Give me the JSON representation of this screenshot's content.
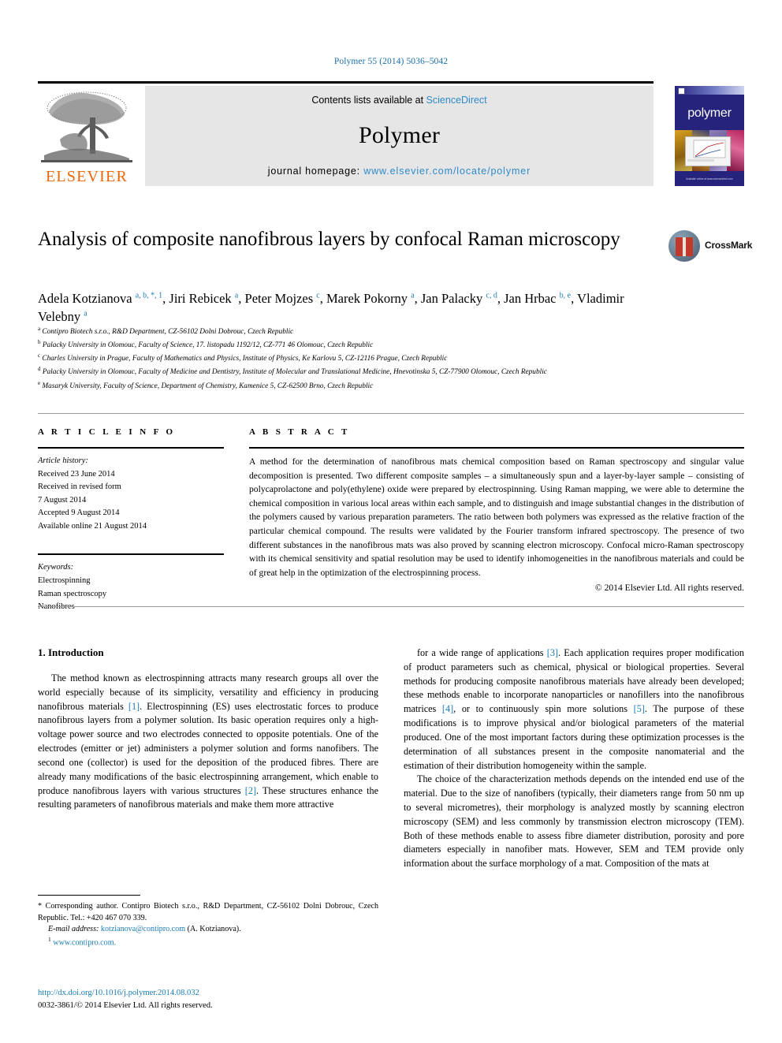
{
  "running_head": "Polymer 55 (2014) 5036–5042",
  "masthead": {
    "contents_prefix": "Contents lists available at ",
    "sciencedirect": "ScienceDirect",
    "journal_name": "Polymer",
    "homepage_label": "journal homepage: ",
    "homepage_url": "www.elsevier.com/locate/polymer",
    "publisher_logo_word": "ELSEVIER",
    "cover_title": "polymer",
    "cover_footer": "Available online at www.sciencedirect.com"
  },
  "article": {
    "title": "Analysis of composite nanofibrous layers by confocal Raman microscopy",
    "crossmark_label": "CrossMark",
    "authors_html": "Adela Kotzianova <sup>a, b, *, 1</sup>, Jiri Rebicek <sup>a</sup>, Peter Mojzes <sup>c</sup>, Marek Pokorny <sup>a</sup>, Jan Palacky <sup>c, d</sup>, Jan Hrbac <sup>b, e</sup>, Vladimir Velebny <sup>a</sup>",
    "affiliations": [
      {
        "mark": "a",
        "text": "Contipro Biotech s.r.o., R&D Department, CZ-56102 Dolni Dobrouc, Czech Republic"
      },
      {
        "mark": "b",
        "text": "Palacky University in Olomouc, Faculty of Science, 17. listopadu 1192/12, CZ-771 46 Olomouc, Czech Republic"
      },
      {
        "mark": "c",
        "text": "Charles University in Prague, Faculty of Mathematics and Physics, Institute of Physics, Ke Karlovu 5, CZ-12116 Prague, Czech Republic"
      },
      {
        "mark": "d",
        "text": "Palacky University in Olomouc, Faculty of Medicine and Dentistry, Institute of Molecular and Translational Medicine, Hnevotinska 5, CZ-77900 Olomouc, Czech Republic"
      },
      {
        "mark": "e",
        "text": "Masaryk University, Faculty of Science, Department of Chemistry, Kamenice 5, CZ-62500 Brno, Czech Republic"
      }
    ]
  },
  "article_info": {
    "heading": "A R T I C L E   I N F O",
    "history_label": "Article history:",
    "history": [
      "Received 23 June 2014",
      "Received in revised form",
      "7 August 2014",
      "Accepted 9 August 2014",
      "Available online 21 August 2014"
    ],
    "keywords_label": "Keywords:",
    "keywords": [
      "Electrospinning",
      "Raman spectroscopy",
      "Nanofibres"
    ]
  },
  "abstract": {
    "heading": "A B S T R A C T",
    "text": "A method for the determination of nanofibrous mats chemical composition based on Raman spectroscopy and singular value decomposition is presented. Two different composite samples – a simultaneously spun and a layer-by-layer sample – consisting of polycaprolactone and poly(ethylene) oxide were prepared by electrospinning. Using Raman mapping, we were able to determine the chemical composition in various local areas within each sample, and to distinguish and image substantial changes in the distribution of the polymers caused by various preparation parameters. The ratio between both polymers was expressed as the relative fraction of the particular chemical compound. The results were validated by the Fourier transform infrared spectroscopy. The presence of two different substances in the nanofibrous mats was also proved by scanning electron microscopy. Confocal micro-Raman spectroscopy with its chemical sensitivity and spatial resolution may be used to identify inhomogeneities in the nanofibrous materials and could be of great help in the optimization of the electrospinning process.",
    "copyright": "© 2014 Elsevier Ltd. All rights reserved."
  },
  "body": {
    "section_heading": "1. Introduction",
    "left_paragraphs": [
      "The method known as electrospinning attracts many research groups all over the world especially because of its simplicity, versatility and efficiency in producing nanofibrous materials [1]. Electrospinning (ES) uses electrostatic forces to produce nanofibrous layers from a polymer solution. Its basic operation requires only a high-voltage power source and two electrodes connected to opposite potentials. One of the electrodes (emitter or jet) administers a polymer solution and forms nanofibers. The second one (collector) is used for the deposition of the produced fibres. There are already many modifications of the basic electrospinning arrangement, which enable to produce nanofibrous layers with various structures [2]. These structures enhance the resulting parameters of nanofibrous materials and make them more attractive"
    ],
    "right_paragraphs": [
      "for a wide range of applications [3]. Each application requires proper modification of product parameters such as chemical, physical or biological properties. Several methods for producing composite nanofibrous materials have already been developed; these methods enable to incorporate nanoparticles or nanofillers into the nanofibrous matrices [4], or to continuously spin more solutions [5]. The purpose of these modifications is to improve physical and/or biological parameters of the material produced. One of the most important factors during these optimization processes is the determination of all substances present in the composite nanomaterial and the estimation of their distribution homogeneity within the sample.",
      "The choice of the characterization methods depends on the intended end use of the material. Due to the size of nanofibers (typically, their diameters range from 50 nm up to several micrometres), their morphology is analyzed mostly by scanning electron microscopy (SEM) and less commonly by transmission electron microscopy (TEM). Both of these methods enable to assess fibre diameter distribution, porosity and pore diameters especially in nanofiber mats. However, SEM and TEM provide only information about the surface morphology of a mat. Composition of the mats at"
    ]
  },
  "footnotes": {
    "corresponding": "* Corresponding author. Contipro Biotech s.r.o., R&D Department, CZ-56102 Dolni Dobrouc, Czech Republic. Tel.: +420 467 070 339.",
    "email_label": "E-mail address:",
    "email": "kotzianova@contipro.com",
    "email_suffix": "(A. Kotzianova).",
    "footnote1_mark": "1",
    "footnote1_url": "www.contipro.com."
  },
  "imprint": {
    "doi": "http://dx.doi.org/10.1016/j.polymer.2014.08.032",
    "issn_line": "0032-3861/© 2014 Elsevier Ltd. All rights reserved."
  },
  "colors": {
    "link_blue": "#1a7bb5",
    "sciencedirect_blue": "#2e8bc9",
    "elsevier_orange": "#eb6608",
    "cover_navy": "#26237c",
    "masthead_grey": "#e6e6e6"
  }
}
